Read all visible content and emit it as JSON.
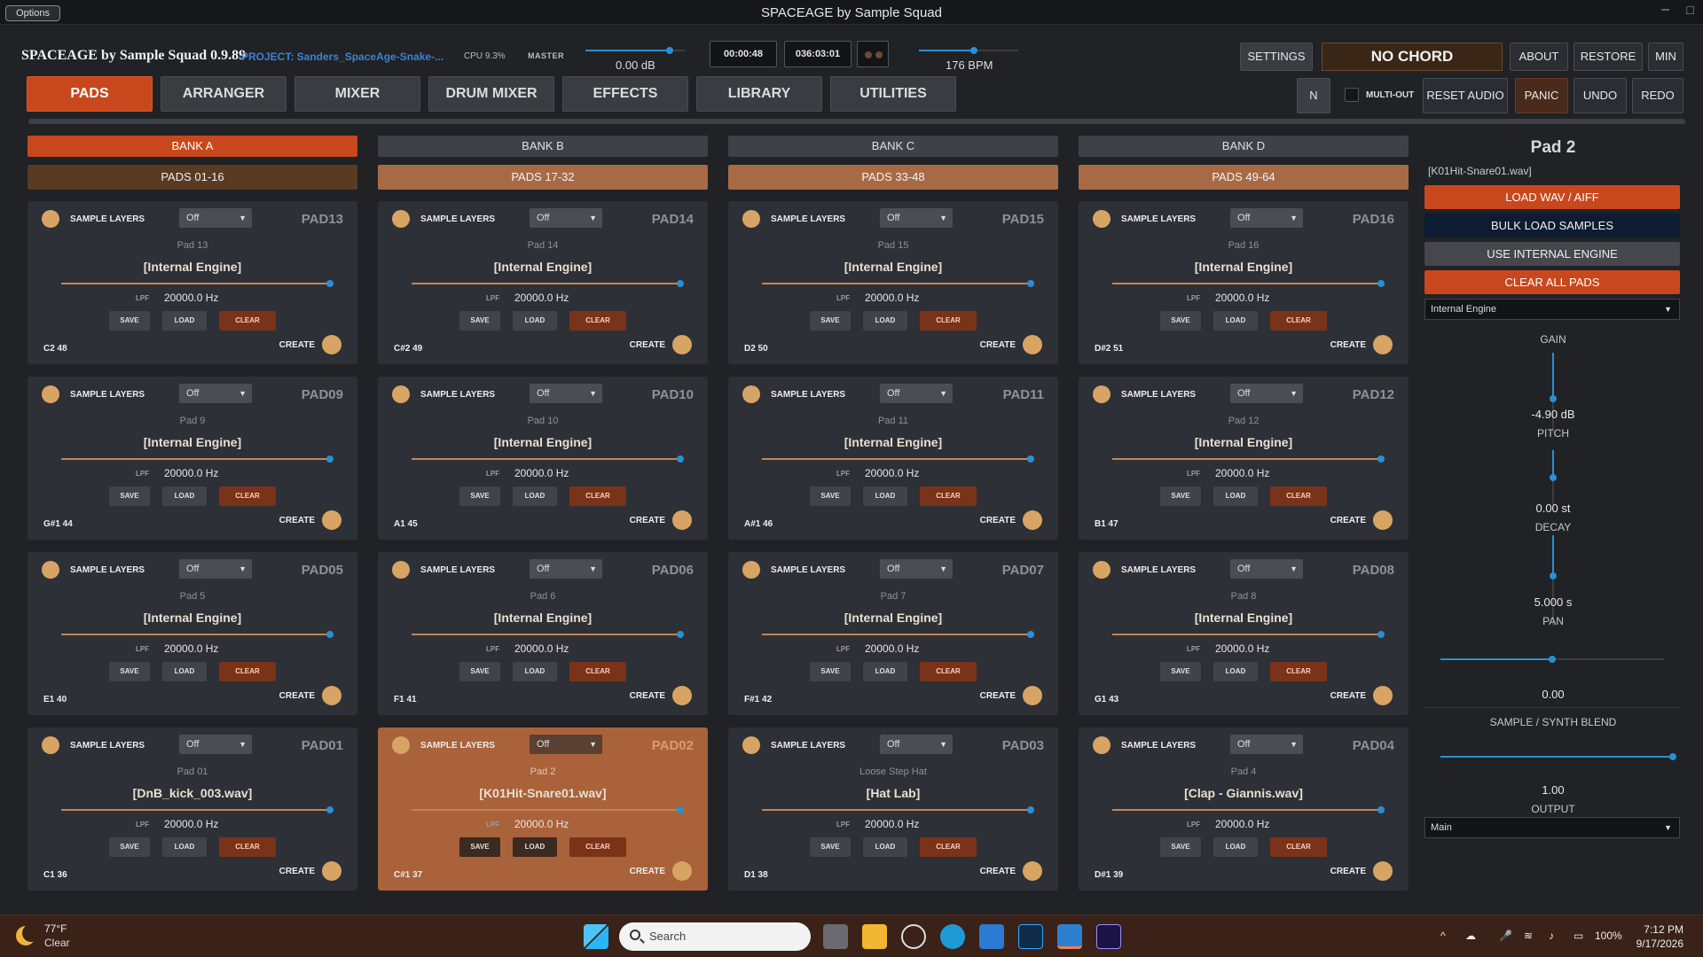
{
  "window": {
    "options_label": "Options",
    "title": "SPACEAGE by Sample Squad"
  },
  "header": {
    "brand": "SPACEAGE by Sample Squad 0.9.89",
    "project": "PROJECT: Sanders_SpaceAge-Snake-...",
    "cpu": "CPU 9.3%",
    "master_label": "MASTER",
    "master_value": "0.00 dB",
    "master_level": 0.85,
    "time1": "00:00:48",
    "time2": "036:03:01",
    "bpm_label": "176 BPM",
    "bpm_level": 0.55,
    "settings": "SETTINGS",
    "chord": "NO CHORD",
    "about": "ABOUT",
    "restore": "RESTORE",
    "min": "MIN",
    "n": "N",
    "multiout": "MULTI-OUT",
    "reset_audio": "RESET AUDIO",
    "panic": "PANIC",
    "undo": "UNDO",
    "redo": "REDO"
  },
  "tabs": [
    "PADS",
    "ARRANGER",
    "MIXER",
    "DRUM MIXER",
    "EFFECTS",
    "LIBRARY",
    "UTILITIES"
  ],
  "banks": [
    {
      "name": "BANK A",
      "range": "PADS 01-16"
    },
    {
      "name": "BANK B",
      "range": "PADS 17-32"
    },
    {
      "name": "BANK C",
      "range": "PADS 33-48"
    },
    {
      "name": "BANK D",
      "range": "PADS 49-64"
    }
  ],
  "pad_common": {
    "layers": "SAMPLE LAYERS",
    "mode": "Off",
    "lpf": "LPF",
    "hz": "20000.0 Hz",
    "save": "SAVE",
    "load": "LOAD",
    "clear": "CLEAR",
    "create": "CREATE"
  },
  "pads": [
    {
      "id": "PAD13",
      "name": "Pad 13",
      "engine": "[Internal Engine]",
      "note": "C2  48"
    },
    {
      "id": "PAD14",
      "name": "Pad 14",
      "engine": "[Internal Engine]",
      "note": "C#2  49"
    },
    {
      "id": "PAD15",
      "name": "Pad 15",
      "engine": "[Internal Engine]",
      "note": "D2  50"
    },
    {
      "id": "PAD16",
      "name": "Pad 16",
      "engine": "[Internal Engine]",
      "note": "D#2  51"
    },
    {
      "id": "PAD09",
      "name": "Pad 9",
      "engine": "[Internal Engine]",
      "note": "G#1  44"
    },
    {
      "id": "PAD10",
      "name": "Pad 10",
      "engine": "[Internal Engine]",
      "note": "A1  45"
    },
    {
      "id": "PAD11",
      "name": "Pad 11",
      "engine": "[Internal Engine]",
      "note": "A#1  46"
    },
    {
      "id": "PAD12",
      "name": "Pad 12",
      "engine": "[Internal Engine]",
      "note": "B1  47"
    },
    {
      "id": "PAD05",
      "name": "Pad 5",
      "engine": "[Internal Engine]",
      "note": "E1  40"
    },
    {
      "id": "PAD06",
      "name": "Pad 6",
      "engine": "[Internal Engine]",
      "note": "F1  41"
    },
    {
      "id": "PAD07",
      "name": "Pad 7",
      "engine": "[Internal Engine]",
      "note": "F#1  42"
    },
    {
      "id": "PAD08",
      "name": "Pad 8",
      "engine": "[Internal Engine]",
      "note": "G1  43"
    },
    {
      "id": "PAD01",
      "name": "Pad 01",
      "engine": "[DnB_kick_003.wav]",
      "note": "C1  36"
    },
    {
      "id": "PAD02",
      "name": "Pad 2",
      "engine": "[K01Hit-Snare01.wav]",
      "note": "C#1  37",
      "selected": true
    },
    {
      "id": "PAD03",
      "name": "Loose Step Hat",
      "engine": "[Hat Lab]",
      "note": "D1  38"
    },
    {
      "id": "PAD04",
      "name": "Pad 4",
      "engine": "[Clap - Giannis.wav]",
      "note": "D#1  39"
    }
  ],
  "side": {
    "title": "Pad 2",
    "file": "[K01Hit-Snare01.wav]",
    "load_wav": "LOAD WAV / AIFF",
    "bulk": "BULK LOAD SAMPLES",
    "use_internal": "USE INTERNAL ENGINE",
    "clear_all": "CLEAR ALL PADS",
    "engine_select": "Internal Engine",
    "gain_label": "GAIN",
    "gain_value": "-4.90 dB",
    "gain_level": 0.42,
    "pitch_label": "PITCH",
    "pitch_value": "0.00 st",
    "pitch_level": 0.5,
    "decay_label": "DECAY",
    "decay_value": "5.000 s",
    "decay_level": 0.55,
    "pan_label": "PAN",
    "pan_value": "0.00",
    "pan_level": 0.5,
    "blend_label": "SAMPLE / SYNTH BLEND",
    "blend_value": "1.00",
    "blend_level": 1.0,
    "output_label": "OUTPUT",
    "output_select": "Main"
  },
  "taskbar": {
    "temp": "77°F",
    "cond": "Clear",
    "search": "Search",
    "battery": "100%",
    "time": "7:12 PM",
    "date": "9/17/2026"
  }
}
